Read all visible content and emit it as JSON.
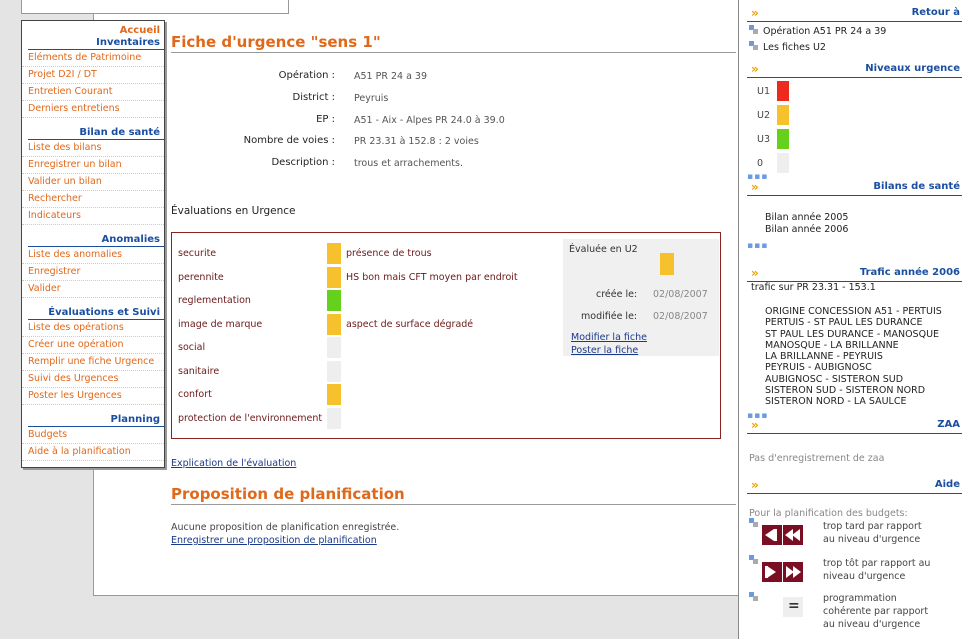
{
  "nav": {
    "accueil": "Accueil",
    "inventaires": "Inventaires",
    "inventaires_items": [
      "Eléments de Patrimoine",
      "Projet D2I / DT",
      "Entretien Courant",
      "Derniers entretiens"
    ],
    "bilan": "Bilan de santé",
    "bilan_items": [
      "Liste des bilans",
      "Enregistrer un bilan",
      "Valider un bilan",
      "Rechercher",
      "Indicateurs"
    ],
    "anomalies": "Anomalies",
    "anomalies_items": [
      "Liste des anomalies",
      "Enregistrer",
      "Valider"
    ],
    "evaluations": "Évaluations et Suivi",
    "evaluations_items": [
      "Liste des opérations",
      "Créer une opération",
      "Remplir une fiche Urgence",
      "Suivi des Urgences",
      "Poster les Urgences"
    ],
    "planning": "Planning",
    "planning_items": [
      "Budgets",
      "Aide à la planification"
    ]
  },
  "page": {
    "title": "Fiche d'urgence \"sens 1\"",
    "info": [
      {
        "label": "Opération :",
        "value": "A51 PR 24 a 39"
      },
      {
        "label": "District :",
        "value": "Peyruis"
      },
      {
        "label": "EP :",
        "value": "A51 - Aix - Alpes PR 24.0 à 39.0"
      },
      {
        "label": "Nombre de voies :",
        "value": "PR 23.31 à 152.8 : 2 voies"
      },
      {
        "label": "Description :",
        "value": "trous et arrachements."
      }
    ],
    "eval_heading": "Évaluations en Urgence",
    "criteria": [
      {
        "label": "securite",
        "color": "#f7c12e",
        "comment": "présence de trous"
      },
      {
        "label": "perennite",
        "color": "#f7c12e",
        "comment": "HS bon mais CFT moyen par endroit"
      },
      {
        "label": "reglementation",
        "color": "#66d11c",
        "comment": ""
      },
      {
        "label": "image de marque",
        "color": "#f7c12e",
        "comment": "aspect de surface dégradé"
      },
      {
        "label": "social",
        "color": "#eeeeee",
        "comment": ""
      },
      {
        "label": "sanitaire",
        "color": "#eeeeee",
        "comment": ""
      },
      {
        "label": "confort",
        "color": "#f7c12e",
        "comment": ""
      },
      {
        "label": "protection de l'environnement",
        "color": "#eeeeee",
        "comment": ""
      }
    ],
    "evaluated_label": "Évaluée en U2",
    "evaluated_color": "#f7c12e",
    "created_label": "créée le:",
    "created_date": "02/08/2007",
    "modified_label": "modifiée le:",
    "modified_date": "02/08/2007",
    "modify_link": "Modifier la fiche",
    "post_link": "Poster la fiche",
    "explanation_link": "Explication de l'évaluation",
    "planning_title": "Proposition de planification",
    "planning_none": "Aucune proposition de planification enregistrée.",
    "planning_link": "Enregistrer une proposition de planification"
  },
  "right": {
    "retour_title": "Retour à",
    "retour_items": [
      "Opération A51 PR 24 a 39",
      "Les fiches U2"
    ],
    "niveaux_title": "Niveaux urgence",
    "niveaux": [
      {
        "label": "U1",
        "color": "#ee2a1e"
      },
      {
        "label": "U2",
        "color": "#f7c12e"
      },
      {
        "label": "U3",
        "color": "#66d11c"
      },
      {
        "label": "0",
        "color": "#eeeeee"
      }
    ],
    "bilans_title": "Bilans de santé",
    "bilans_items": [
      "Bilan année 2005",
      "Bilan année 2006"
    ],
    "trafic_title": "Trafic année 2006",
    "trafic_sub": "trafic sur PR 23.31 - 153.1",
    "trafic_lines": [
      "ORIGINE CONCESSION A51 - PERTUIS",
      "PERTUIS - ST PAUL LES DURANCE",
      "ST PAUL LES DURANCE - MANOSQUE",
      "MANOSQUE - LA BRILLANNE",
      "LA BRILLANNE - PEYRUIS",
      "PEYRUIS - AUBIGNOSC",
      "AUBIGNOSC - SISTERON SUD",
      "SISTERON SUD - SISTERON NORD",
      "SISTERON NORD - LA SAULCE"
    ],
    "zaa_title": "ZAA",
    "zaa_text": "Pas d'enregistrement de zaa",
    "aide_title": "Aide",
    "aide_intro": "Pour la planification des budgets:",
    "aide_late": [
      "trop tard par rapport",
      "au niveau d'urgence"
    ],
    "aide_early": [
      "trop tôt par rapport au",
      "niveau d'urgence"
    ],
    "aide_ok": [
      "programmation",
      "cohérente par rapport",
      "au niveau d'urgence"
    ],
    "chevron": "»",
    "dots": "▪▪▪",
    "equal_glyph": "="
  }
}
